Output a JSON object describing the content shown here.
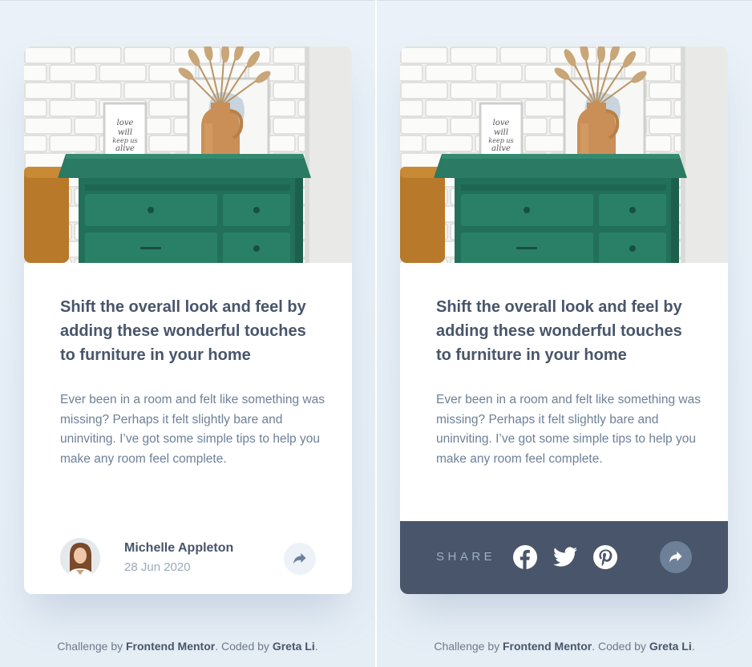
{
  "colors": {
    "page_bg": "#e7eef5",
    "heading": "#48556a",
    "body_text": "#6e8098",
    "muted": "#9aaabb",
    "share_bar_bg": "#48556a",
    "share_btn_bg": "#ecf2f8",
    "share_btn_active_bg": "#6e8098"
  },
  "cards": [
    {
      "state": "default",
      "image": "drawers-photo",
      "title": "Shift the overall look and feel by adding these wonderful touches to furniture in your home",
      "description": "Ever been in a room and felt like something was missing? Perhaps it felt slightly bare and uninviting. I’ve got some simple tips to help you make any room feel complete.",
      "author": {
        "name": "Michelle Appleton",
        "date": "28 Jun 2020",
        "avatar": "avatar-photo"
      },
      "share_icon": "share-arrow-icon"
    },
    {
      "state": "share-open",
      "image": "drawers-photo",
      "title": "Shift the overall look and feel by adding these wonderful touches to furniture in your home",
      "description": "Ever been in a room and felt like something was missing? Perhaps it felt slightly bare and uninviting. I’ve got some simple tips to help you make any room feel complete.",
      "share": {
        "label": "SHARE",
        "networks": [
          "facebook-icon",
          "twitter-icon",
          "pinterest-icon"
        ]
      },
      "share_icon": "share-arrow-icon"
    }
  ],
  "footer": {
    "prefix": "Challenge by ",
    "challenge_link": "Frontend Mentor",
    "middle": ". Coded by ",
    "author_link": "Greta Li",
    "suffix": "."
  }
}
